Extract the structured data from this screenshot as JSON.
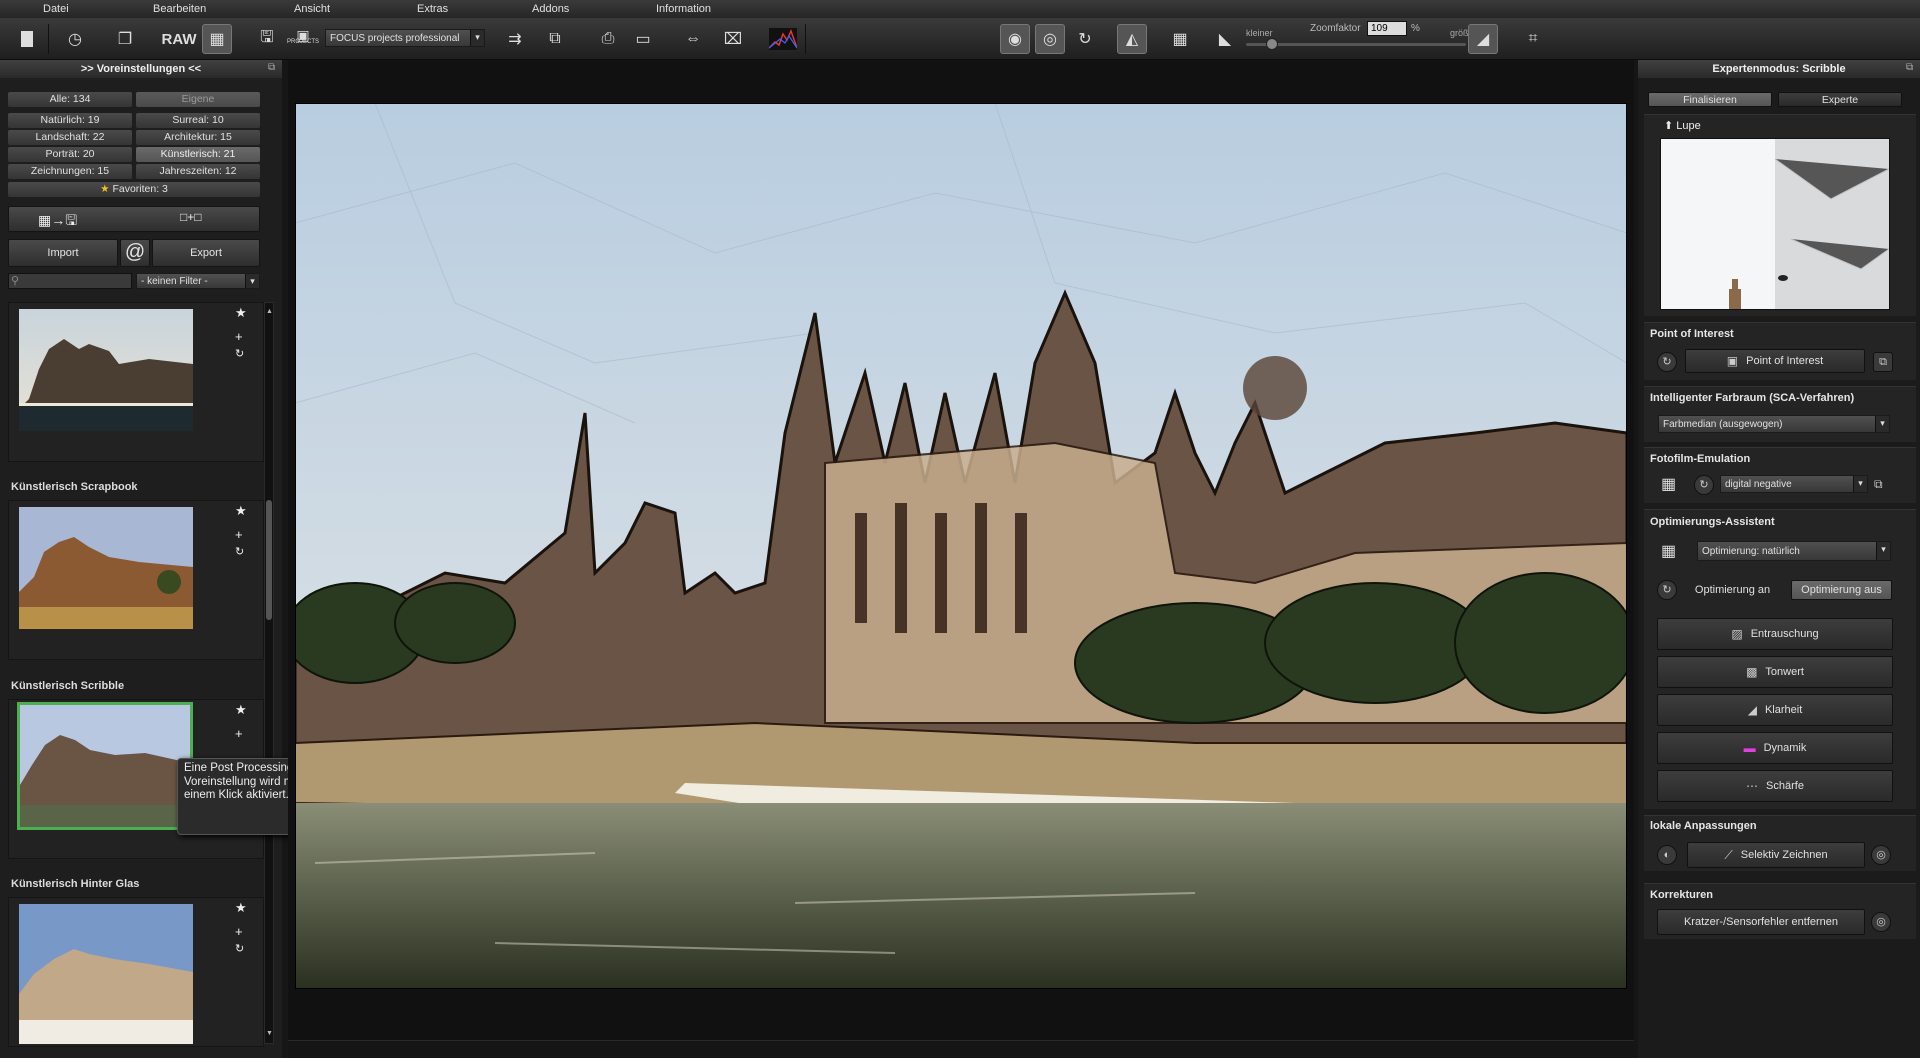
{
  "menu": [
    "Datei",
    "Bearbeiten",
    "Ansicht",
    "Extras",
    "Addons",
    "Information"
  ],
  "toolbar": {
    "raw_label": "RAW",
    "projects_label": "PROJECTS",
    "project_combo": "FOCUS projects professional",
    "zoom_smaller": "kleiner",
    "zoom_label": "Zoomfaktor",
    "zoom_value": "109",
    "zoom_unit": "%",
    "zoom_larger": "größer"
  },
  "left_panel": {
    "title": ">> Voreinstellungen <<",
    "categories": [
      {
        "label": "Alle: 134"
      },
      {
        "label": "Eigene"
      },
      {
        "label": "Natürlich: 19"
      },
      {
        "label": "Surreal: 10"
      },
      {
        "label": "Landschaft: 22"
      },
      {
        "label": "Architektur: 15"
      },
      {
        "label": "Porträt: 20"
      },
      {
        "label": "Künstlerisch: 21"
      },
      {
        "label": "Zeichnungen: 15"
      },
      {
        "label": "Jahreszeiten: 12"
      }
    ],
    "favorites": "Favoriten: 3",
    "import_label": "Import",
    "at_label": "@",
    "export_label": "Export",
    "filter_value": "- keinen Filter -",
    "presets": [
      {
        "label": ""
      },
      {
        "label": "Künstlerisch Scrapbook"
      },
      {
        "label": "Künstlerisch Scribble"
      },
      {
        "label": "Künstlerisch Hinter Glas"
      }
    ],
    "tooltip": "Eine Post Processing Voreinstellung wird mit einem Klick aktiviert."
  },
  "right_panel": {
    "title": "Expertenmodus: Scribble",
    "tab_finalize": "Finalisieren",
    "tab_expert": "Experte",
    "loupe_label": "Lupe",
    "poi_title": "Point of Interest",
    "poi_button": "Point of Interest",
    "sca_title": "Intelligenter Farbraum (SCA-Verfahren)",
    "sca_value": "Farbmedian (ausgewogen)",
    "film_title": "Fotofilm-Emulation",
    "film_value": "digital negative",
    "opt_title": "Optimierungs-Assistent",
    "opt_value": "Optimierung: natürlich",
    "opt_on": "Optimierung an",
    "opt_off": "Optimierung aus",
    "tools": [
      "Entrauschung",
      "Tonwert",
      "Klarheit",
      "Dynamik",
      "Schärfe"
    ],
    "local_title": "lokale Anpassungen",
    "local_button": "Selektiv Zeichnen",
    "corr_title": "Korrekturen",
    "corr_button": "Kratzer-/Sensorfehler entfernen"
  }
}
